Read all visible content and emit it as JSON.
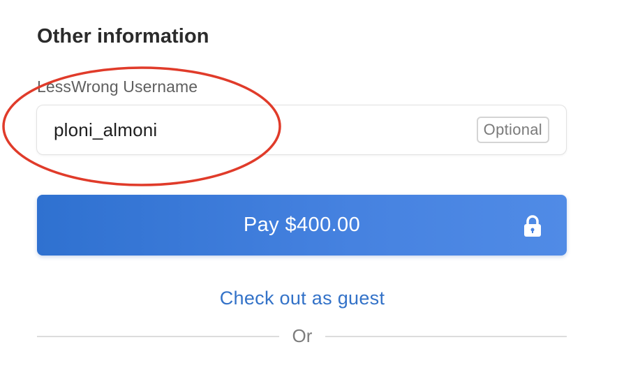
{
  "section": {
    "title": "Other information"
  },
  "username_field": {
    "label": "LessWrong Username",
    "value": "ploni_almoni",
    "badge": "Optional"
  },
  "pay_button": {
    "label": "Pay $400.00",
    "icon": "lock-icon"
  },
  "guest_link": {
    "label": "Check out as guest"
  },
  "divider": {
    "label": "Or"
  },
  "colors": {
    "accent": "#3372c8",
    "button_start": "#2f71d0",
    "button_end": "#508be6",
    "annotation": "#e03b2a"
  }
}
